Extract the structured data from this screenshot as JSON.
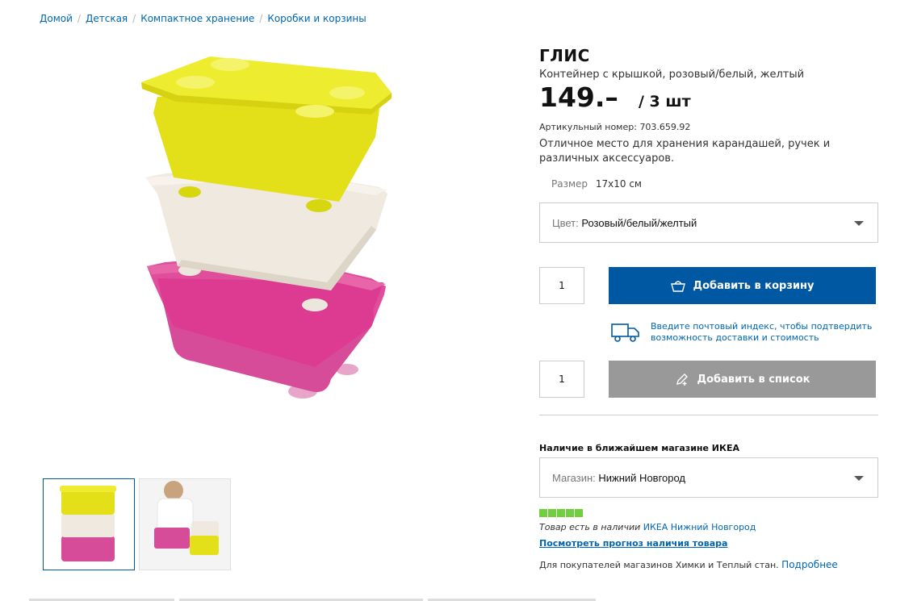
{
  "breadcrumb": [
    {
      "label": "Домой"
    },
    {
      "label": "Детская"
    },
    {
      "label": "Компактное хранение"
    },
    {
      "label": "Коробки и корзины"
    }
  ],
  "breadcrumb_separator": "/",
  "product": {
    "name": "ГЛИС",
    "subtitle": "Контейнер с крышкой, розовый/белый, желтый",
    "price": "149.–",
    "unit": "/ 3 шт",
    "article_label": "Артикульный номер:",
    "article_number": "703.659.92",
    "description": "Отличное место для хранения карандашей, ручек и различных аксессуаров.",
    "size_label": "Размер",
    "size_value": "17x10 см",
    "colors": {
      "yellow": "#e9e51a",
      "white": "#f2ece0",
      "pink": "#d7338e"
    }
  },
  "color_select": {
    "label": "Цвет:",
    "value": "Розовый/белый/желтый"
  },
  "cart": {
    "quantity": "1",
    "button_label": "Добавить в корзину",
    "button_color": "#0058a3"
  },
  "delivery": {
    "text": "Введите почтовый индекс, чтобы подтвердить возможность доставки и стоимость"
  },
  "wishlist": {
    "quantity": "1",
    "button_label": "Добавить в список",
    "button_color": "#999999"
  },
  "availability": {
    "title": "Наличие в ближайшем магазине ИКЕА",
    "store_label": "Магазин:",
    "store_value": "Нижний Новгород",
    "stock_level": 5,
    "stock_max": 5,
    "stock_color": "#6fcf3f",
    "stock_text": "Товар есть в наличии",
    "stock_store_link": "ИКЕА Нижний Новгород",
    "forecast_link": "Посмотреть прогноз наличия товара",
    "note_text": "Для покупателей магазинов Химки и Теплый стан.",
    "note_link": "Подробнее"
  }
}
